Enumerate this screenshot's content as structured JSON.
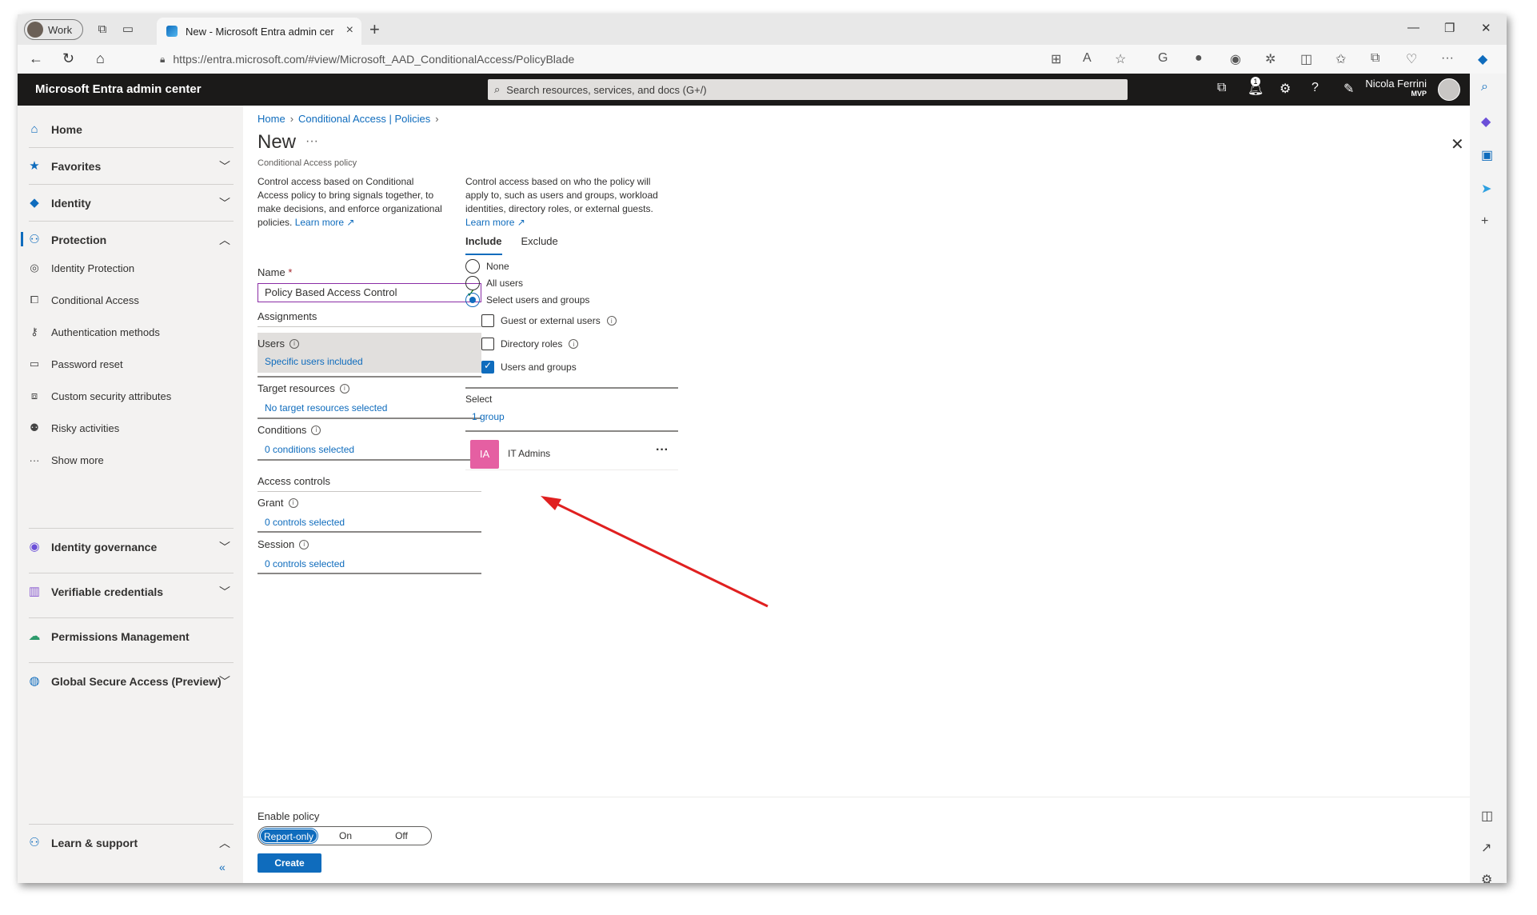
{
  "browser": {
    "profile_label": "Work",
    "tab_title": "New - Microsoft Entra admin cer",
    "url": "https://entra.microsoft.com/#view/Microsoft_AAD_ConditionalAccess/PolicyBlade"
  },
  "header": {
    "app_title": "Microsoft Entra admin center",
    "search_placeholder": "Search resources, services, and docs (G+/)",
    "notification_count": "1",
    "user_name": "Nicola Ferrini",
    "user_tag": "MVP"
  },
  "sidebar": {
    "items": [
      {
        "label": "Home",
        "icon": "home-icon"
      },
      {
        "label": "Favorites",
        "icon": "star-icon"
      },
      {
        "label": "Identity",
        "icon": "identity-icon"
      },
      {
        "label": "Protection",
        "icon": "protection-icon"
      },
      {
        "label": "Identity governance",
        "icon": "governance-icon"
      },
      {
        "label": "Verifiable credentials",
        "icon": "credentials-icon"
      },
      {
        "label": "Permissions Management",
        "icon": "cloud-icon"
      },
      {
        "label": "Global Secure Access (Preview)",
        "icon": "globe-icon"
      },
      {
        "label": "Learn & support",
        "icon": "support-icon"
      }
    ],
    "protection_sub": [
      {
        "label": "Identity Protection"
      },
      {
        "label": "Conditional Access"
      },
      {
        "label": "Authentication methods"
      },
      {
        "label": "Password reset"
      },
      {
        "label": "Custom security attributes"
      },
      {
        "label": "Risky activities"
      },
      {
        "label": "Show more"
      }
    ]
  },
  "page": {
    "breadcrumb": [
      "Home",
      "Conditional Access | Policies"
    ],
    "title": "New",
    "subtitle": "Conditional Access policy",
    "left_desc": "Control access based on Conditional Access policy to bring signals together, to make decisions, and enforce organizational policies.",
    "right_desc": "Control access based on who the policy will apply to, such as users and groups, workload identities, directory roles, or external guests.",
    "learn_more": "Learn more",
    "name_label": "Name",
    "name_value": "Policy Based Access Control",
    "assignments_label": "Assignments",
    "users_label": "Users",
    "users_value": "Specific users included",
    "target_label": "Target resources",
    "target_value": "No target resources selected",
    "conditions_label": "Conditions",
    "conditions_value": "0 conditions selected",
    "access_controls_label": "Access controls",
    "grant_label": "Grant",
    "grant_value": "0 controls selected",
    "session_label": "Session",
    "session_value": "0 controls selected"
  },
  "include_pane": {
    "tabs": [
      "Include",
      "Exclude"
    ],
    "active_tab": "Include",
    "radios": [
      {
        "label": "None",
        "selected": false
      },
      {
        "label": "All users",
        "selected": false
      },
      {
        "label": "Select users and groups",
        "selected": true
      }
    ],
    "checkboxes": [
      {
        "label": "Guest or external users",
        "checked": false
      },
      {
        "label": "Directory roles",
        "checked": false
      },
      {
        "label": "Users and groups",
        "checked": true
      }
    ],
    "select_label": "Select",
    "select_value": "1 group",
    "group_initials": "IA",
    "group_name": "IT Admins"
  },
  "footer": {
    "enable_label": "Enable policy",
    "options": [
      "Report-only",
      "On",
      "Off"
    ],
    "selected": "Report-only",
    "create_label": "Create"
  },
  "colors": {
    "accent": "#0f6cbd",
    "header_bg": "#1b1a19",
    "group_avatar": "#e55fa2",
    "annotation_arrow": "#e02020"
  }
}
